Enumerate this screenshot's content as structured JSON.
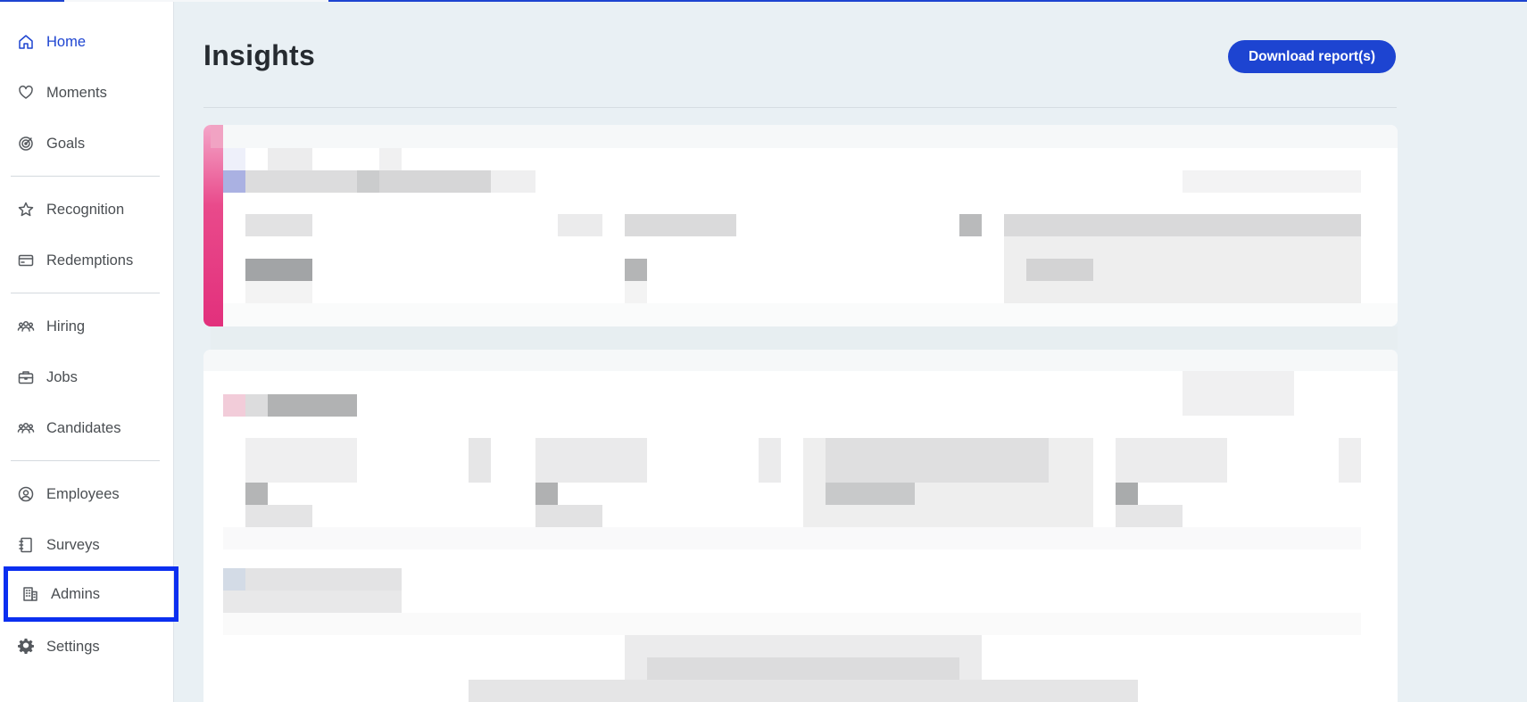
{
  "page": {
    "title": "Insights"
  },
  "header": {
    "download_label": "Download report(s)"
  },
  "sidebar": {
    "items": [
      {
        "label": "Home",
        "icon": "home-icon",
        "active": true
      },
      {
        "label": "Moments",
        "icon": "heart-icon"
      },
      {
        "label": "Goals",
        "icon": "target-icon"
      },
      {
        "label": "Recognition",
        "icon": "star-icon"
      },
      {
        "label": "Redemptions",
        "icon": "card-icon"
      },
      {
        "label": "Hiring",
        "icon": "people-icon"
      },
      {
        "label": "Jobs",
        "icon": "briefcase-icon"
      },
      {
        "label": "Candidates",
        "icon": "people-icon"
      },
      {
        "label": "Employees",
        "icon": "user-circle-icon"
      },
      {
        "label": "Surveys",
        "icon": "notebook-icon"
      },
      {
        "label": "Admins",
        "icon": "building-icon",
        "highlighted": true
      },
      {
        "label": "Settings",
        "icon": "gear-icon"
      }
    ]
  },
  "colors": {
    "brand": "#1d44d1",
    "highlight": "#0b2ff0",
    "accent_pink": "#e2307c",
    "background": "#e9f0f4"
  }
}
